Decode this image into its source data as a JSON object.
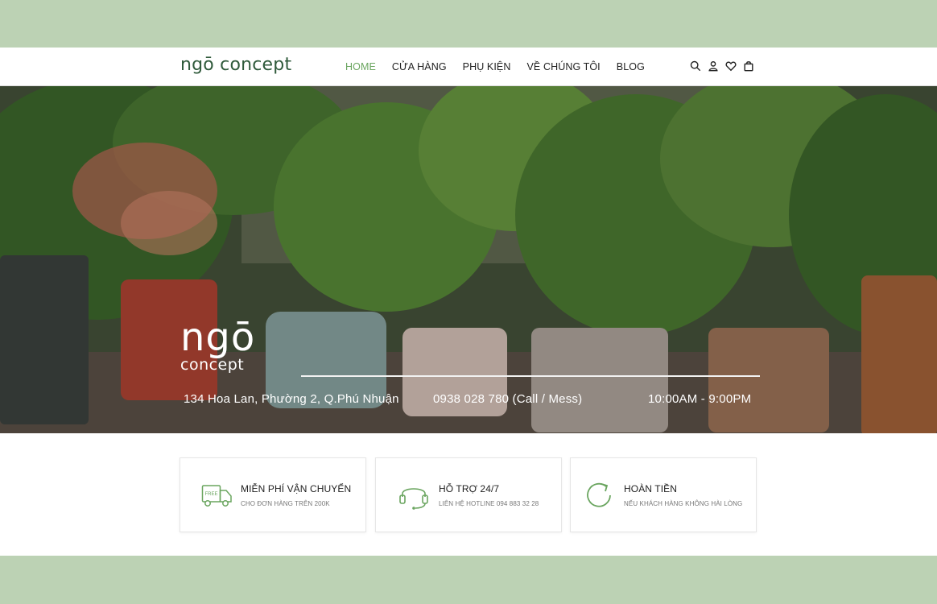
{
  "header": {
    "logo": "ngō concept",
    "nav": [
      {
        "label": "HOME",
        "active": true
      },
      {
        "label": "CỬA HÀNG",
        "active": false
      },
      {
        "label": "PHỤ KIỆN",
        "active": false
      },
      {
        "label": "VỀ CHÚNG TÔI",
        "active": false
      },
      {
        "label": "BLOG",
        "active": false
      }
    ],
    "icons": [
      "search-icon",
      "user-icon",
      "heart-icon",
      "bag-icon"
    ]
  },
  "hero": {
    "logo_big": "ngō",
    "logo_small": "concept",
    "address": "134 Hoa Lan, Phường 2, Q.Phú Nhuận",
    "phone": "0938 028 780 (Call / Mess)",
    "hours": "10:00AM - 9:00PM"
  },
  "features": [
    {
      "icon": "truck-icon",
      "icon_text": "FREE",
      "title": "MIỄN PHÍ VẬN CHUYỂN",
      "subtitle": "CHO ĐƠN HÀNG TRÊN 200K"
    },
    {
      "icon": "headset-icon",
      "title": "HỖ TRỢ 24/7",
      "subtitle": "LIÊN HỆ HOTLINE 094 883 32 28"
    },
    {
      "icon": "refresh-icon",
      "title": "HOÀN TIỀN",
      "subtitle": "NẾU KHÁCH HÀNG KHÔNG HÀI LÒNG"
    }
  ],
  "colors": {
    "band": "#bcd2b4",
    "accent": "#6aa55f",
    "logo": "#2f5a3b"
  }
}
